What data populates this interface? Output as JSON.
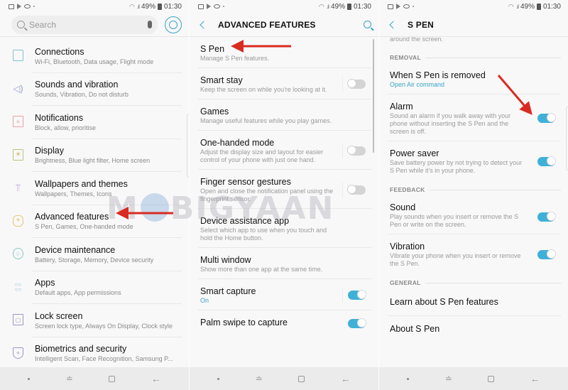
{
  "status_bar": {
    "battery": "49%",
    "time": "01:30"
  },
  "colors": {
    "accent": "#3aa3c6",
    "toggle_on": "#3fb0d8",
    "arrow": "#d92b22",
    "nav_bg": "#ebebeb"
  },
  "settings_screen": {
    "search_placeholder": "Search",
    "icons": {
      "search": "search-icon",
      "mic": "mic-icon",
      "profile": "profile-icon"
    },
    "items": [
      {
        "icon": "connections-icon",
        "title": "Connections",
        "subtitle": "Wi-Fi, Bluetooth, Data usage, Flight mode"
      },
      {
        "icon": "speaker-icon",
        "title": "Sounds and vibration",
        "subtitle": "Sounds, Vibration, Do not disturb"
      },
      {
        "icon": "notifications-icon",
        "title": "Notifications",
        "subtitle": "Block, allow, prioritise"
      },
      {
        "icon": "display-icon",
        "title": "Display",
        "subtitle": "Brightness, Blue light filter, Home screen"
      },
      {
        "icon": "paintbrush-icon",
        "title": "Wallpapers and themes",
        "subtitle": "Wallpapers, Themes, Icons"
      },
      {
        "icon": "advanced-features-icon",
        "title": "Advanced features",
        "subtitle": "S Pen, Games, One-handed mode"
      },
      {
        "icon": "device-maintenance-icon",
        "title": "Device maintenance",
        "subtitle": "Battery, Storage, Memory, Device security"
      },
      {
        "icon": "apps-icon",
        "title": "Apps",
        "subtitle": "Default apps, App permissions"
      },
      {
        "icon": "lock-icon",
        "title": "Lock screen",
        "subtitle": "Screen lock type, Always On Display, Clock style"
      },
      {
        "icon": "shield-icon",
        "title": "Biometrics and security",
        "subtitle": "Intelligent Scan, Face Recognition, Samsung P..."
      }
    ]
  },
  "advanced_screen": {
    "title": "ADVANCED FEATURES",
    "items": [
      {
        "title": "S Pen",
        "subtitle": "Manage S Pen features.",
        "toggle": null
      },
      {
        "title": "Smart stay",
        "subtitle": "Keep the screen on while you're looking at it.",
        "toggle": false
      },
      {
        "title": "Games",
        "subtitle": "Manage useful features while you play games.",
        "toggle": null
      },
      {
        "title": "One-handed mode",
        "subtitle": "Adjust the display size and layout for easier control of your phone with just one hand.",
        "toggle": false
      },
      {
        "title": "Finger sensor gestures",
        "subtitle": "Open and close the notification panel using the fingerprint sensor.",
        "toggle": false
      },
      {
        "title": "Device assistance app",
        "subtitle": "Select which app to use when you touch and hold the Home button.",
        "toggle": null
      },
      {
        "title": "Multi window",
        "subtitle": "Show more than one app at the same time.",
        "toggle": null
      },
      {
        "title": "Smart capture",
        "subtitle": "On",
        "toggle": true
      },
      {
        "title": "Palm swipe to capture",
        "subtitle": "",
        "toggle": true
      }
    ]
  },
  "spen_screen": {
    "title": "S PEN",
    "clipped_text": "around the screen.",
    "sections": [
      {
        "header": "REMOVAL",
        "items": [
          {
            "title": "When S Pen is removed",
            "subtitle": "Open Air command",
            "toggle": null
          },
          {
            "title": "Alarm",
            "subtitle": "Sound an alarm if you walk away with your phone without inserting the S Pen and the screen is off.",
            "toggle": true
          },
          {
            "title": "Power saver",
            "subtitle": "Save battery power by not trying to detect your S Pen while it's in your phone.",
            "toggle": true
          }
        ]
      },
      {
        "header": "FEEDBACK",
        "items": [
          {
            "title": "Sound",
            "subtitle": "Play sounds when you insert or remove the S Pen or write on the screen.",
            "toggle": true
          },
          {
            "title": "Vibration",
            "subtitle": "Vibrate your phone when you insert or remove the S Pen.",
            "toggle": true
          }
        ]
      },
      {
        "header": "GENERAL",
        "items": [
          {
            "title": "Learn about S Pen features",
            "subtitle": "",
            "toggle": null
          },
          {
            "title": "About S Pen",
            "subtitle": "",
            "toggle": null
          }
        ]
      }
    ]
  },
  "watermark": {
    "left": "M",
    "right": "BIGYAAN"
  }
}
